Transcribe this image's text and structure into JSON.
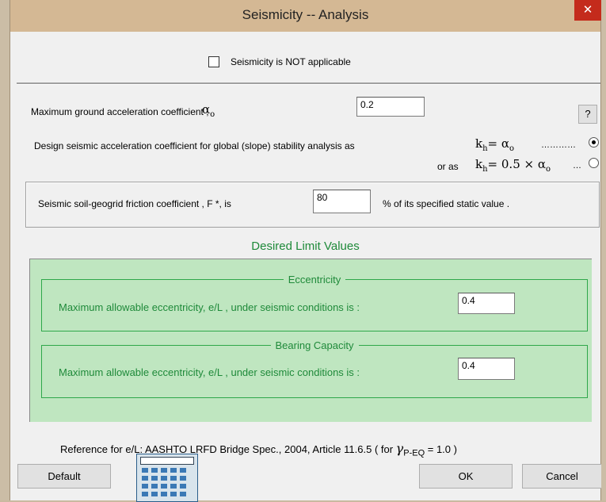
{
  "window": {
    "title": "Seismicity -- Analysis",
    "close_glyph": "✕"
  },
  "not_applicable": {
    "label": "Seismicity is NOT applicable",
    "checked": false
  },
  "ground_accel": {
    "label": "Maximum ground acceleration coefficient ,",
    "symbol": "α",
    "symbol_sub": "o",
    "value": "0.2"
  },
  "help_button": {
    "label": "?"
  },
  "design_coeff": {
    "label": "Design seismic acceleration coefficient for global (slope) stability analysis as",
    "option1_formula": "k",
    "option1_sub": "h",
    "option1_rhs": "= α",
    "option1_rhs_sub": "o",
    "option1_leader": "…………",
    "option2_prefix": "or as",
    "option2_formula": "k",
    "option2_sub": "h",
    "option2_rhs": "= 0.5 × α",
    "option2_rhs_sub": "o",
    "option2_leader": "…",
    "selected": 1
  },
  "friction": {
    "label_before": "Seismic soil-geogrid friction coefficient , F *,  is",
    "value": "80",
    "label_after": "%  of  its specified static value ."
  },
  "limits": {
    "heading": "Desired Limit Values",
    "eccentricity": {
      "title": "Eccentricity",
      "label": "Maximum allowable eccentricity, e/L , under seismic conditions is :",
      "value": "0.4"
    },
    "bearing": {
      "title": "Bearing Capacity",
      "label": "Maximum allowable eccentricity, e/L , under seismic conditions is :",
      "value": "0.4"
    }
  },
  "reference": {
    "text_before": "Reference for e/L:  AASHTO LRFD Bridge Spec., 2004, Article 11.6.5  ( for ",
    "gamma": "γ",
    "gamma_sub": "P-EQ",
    "text_after": " = 1.0 )"
  },
  "buttons": {
    "default": "Default",
    "ok": "OK",
    "cancel": "Cancel"
  },
  "colors": {
    "title_bar": "#d4b894",
    "close": "#c42b1c",
    "panel_green": "#bfe6c0",
    "green_text": "#1f8a3a"
  }
}
